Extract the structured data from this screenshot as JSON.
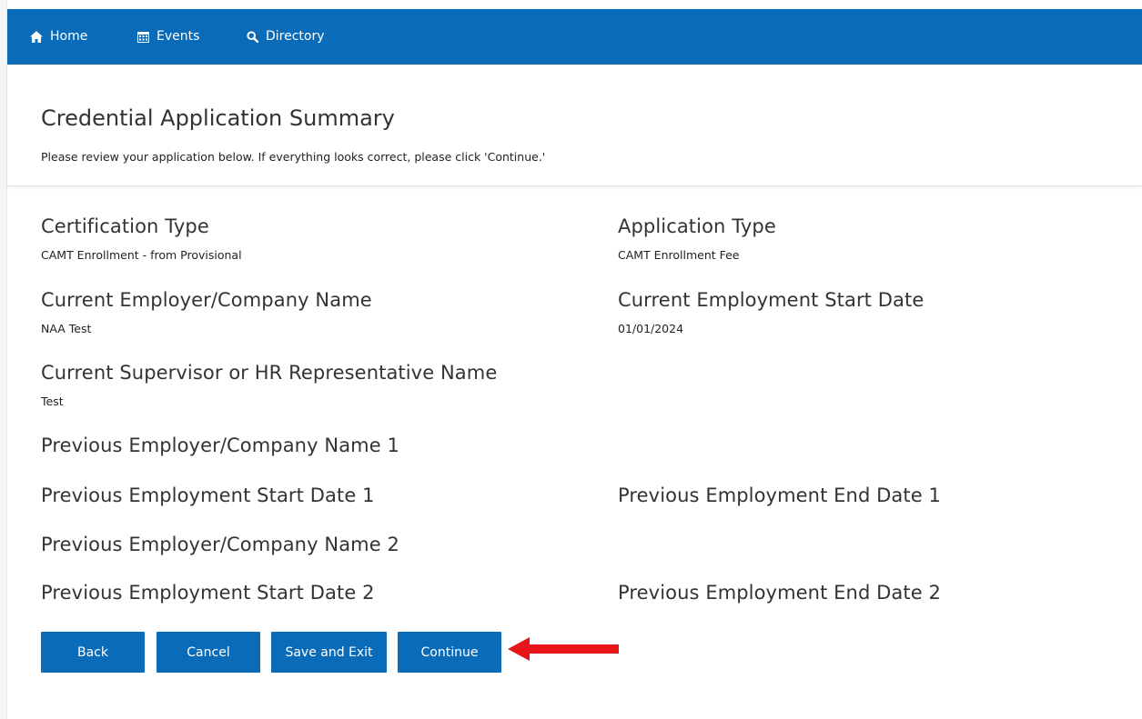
{
  "nav": {
    "items": [
      {
        "label": "Home",
        "icon": "home-icon"
      },
      {
        "label": "Events",
        "icon": "calendar-icon"
      },
      {
        "label": "Directory",
        "icon": "search-icon"
      }
    ],
    "background": "#0a6bb8"
  },
  "header": {
    "title": "Credential Application Summary",
    "subtitle": "Please review your application below. If everything looks correct, please click 'Continue.'"
  },
  "fields": {
    "certification_type": {
      "label": "Certification Type",
      "value": "CAMT Enrollment - from Provisional"
    },
    "application_type": {
      "label": "Application Type",
      "value": "CAMT Enrollment Fee"
    },
    "current_employer": {
      "label": "Current Employer/Company Name",
      "value": "NAA Test"
    },
    "current_start_date": {
      "label": "Current Employment Start Date",
      "value": "01/01/2024"
    },
    "supervisor": {
      "label": "Current Supervisor or HR Representative Name",
      "value": "Test"
    },
    "prev_employer_1": {
      "label": "Previous Employer/Company Name 1",
      "value": ""
    },
    "prev_start_1": {
      "label": "Previous Employment Start Date 1",
      "value": ""
    },
    "prev_end_1": {
      "label": "Previous Employment End Date 1",
      "value": ""
    },
    "prev_employer_2": {
      "label": "Previous Employer/Company Name 2",
      "value": ""
    },
    "prev_start_2": {
      "label": "Previous Employment Start Date 2",
      "value": ""
    },
    "prev_end_2": {
      "label": "Previous Employment End Date 2",
      "value": ""
    }
  },
  "buttons": {
    "back": "Back",
    "cancel": "Cancel",
    "save_exit": "Save and Exit",
    "continue": "Continue"
  },
  "annotation": {
    "icon": "red-arrow-icon",
    "color": "#e8161b"
  }
}
